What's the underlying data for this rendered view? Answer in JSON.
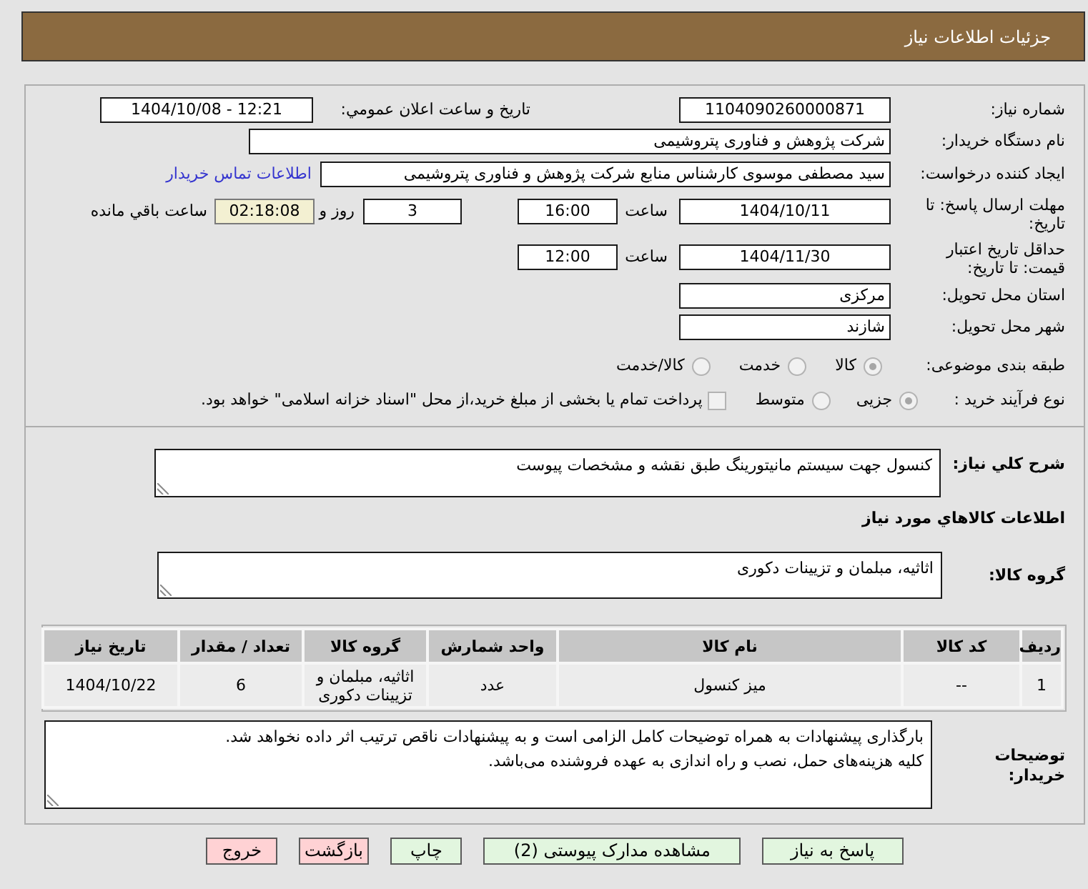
{
  "header": {
    "title": "جزئیات اطلاعات نیاز"
  },
  "need_info": {
    "need_number": {
      "label": "شماره نیاز:",
      "value": "1104090260000871"
    },
    "announce": {
      "label": "تاریخ و ساعت اعلان عمومي:",
      "value": "1404/10/08 - 12:21"
    },
    "buyer_org": {
      "label": "نام دستگاه خریدار:",
      "value": "شرکت پژوهش و فناوری پتروشیمی"
    },
    "requester": {
      "label": "ایجاد کننده درخواست:",
      "value": "سید مصطفی موسوی کارشناس منابع شرکت پژوهش و فناوری پتروشیمی",
      "contact_link": "اطلاعات تماس خریدار"
    },
    "reply_deadline": {
      "label": "مهلت ارسال پاسخ: تا تاریخ:",
      "date": "1404/10/11",
      "time_label": "ساعت",
      "time": "16:00",
      "days": "3",
      "days_label": "روز و",
      "remaining": "02:18:08",
      "remaining_label": "ساعت باقي مانده"
    },
    "price_validity": {
      "label": "حداقل تاریخ اعتبار قیمت: تا تاریخ:",
      "date": "1404/11/30",
      "time_label": "ساعت",
      "time": "12:00"
    },
    "province": {
      "label": "استان محل تحویل:",
      "value": "مرکزی"
    },
    "city": {
      "label": "شهر محل تحویل:",
      "value": "شازند"
    },
    "category": {
      "label": "طبقه بندی موضوعی:",
      "disabled": true,
      "options": [
        {
          "label": "کالا",
          "selected": true
        },
        {
          "label": "خدمت",
          "selected": false
        },
        {
          "label": "کالا/خدمت",
          "selected": false
        }
      ]
    },
    "process": {
      "label": "نوع فرآیند خرید :",
      "disabled": true,
      "options": [
        {
          "label": "جزیی",
          "selected": true
        },
        {
          "label": "متوسط",
          "selected": false
        }
      ],
      "treasury_payment": {
        "label": "پرداخت تمام یا بخشی از مبلغ خرید،از محل \"اسناد خزانه اسلامی\" خواهد بود.",
        "checked": false
      }
    }
  },
  "description": {
    "label": "شرح کلي نیاز:",
    "value": "کنسول جهت سیستم مانیتورینگ طبق نقشه و مشخصات پیوست"
  },
  "goods": {
    "title": "اطلاعات کالاهاي مورد نیاز",
    "group_label": "گروه کالا:",
    "group_value": "اثاثیه، مبلمان و تزیینات دکوری",
    "table": {
      "columns": [
        "ردیف",
        "کد کالا",
        "نام کالا",
        "واحد شمارش",
        "گروه کالا",
        "تعداد / مقدار",
        "تاریخ نیاز"
      ],
      "rows": [
        [
          "1",
          "--",
          "میز کنسول",
          "عدد",
          "اثاثیه، مبلمان و تزیینات دکوری",
          "6",
          "1404/10/22"
        ]
      ]
    }
  },
  "buyer_notes": {
    "label": "توضیحات خریدار:",
    "value": "بارگذاری پیشنهادات به همراه توضیحات کامل الزامی است و به پیشنهادات ناقص ترتیب اثر داده نخواهد شد.\nکلیه هزینه‌های حمل، نصب و راه اندازی به عهده فروشنده می‌باشد."
  },
  "buttons": [
    {
      "label": "پاسخ به نیاز",
      "kind": "action"
    },
    {
      "label": "مشاهده مدارک پیوستی (2)",
      "kind": "action"
    },
    {
      "label": "چاپ",
      "kind": "action"
    },
    {
      "label": "بازگشت",
      "kind": "exit"
    },
    {
      "label": "خروج",
      "kind": "exit"
    }
  ]
}
